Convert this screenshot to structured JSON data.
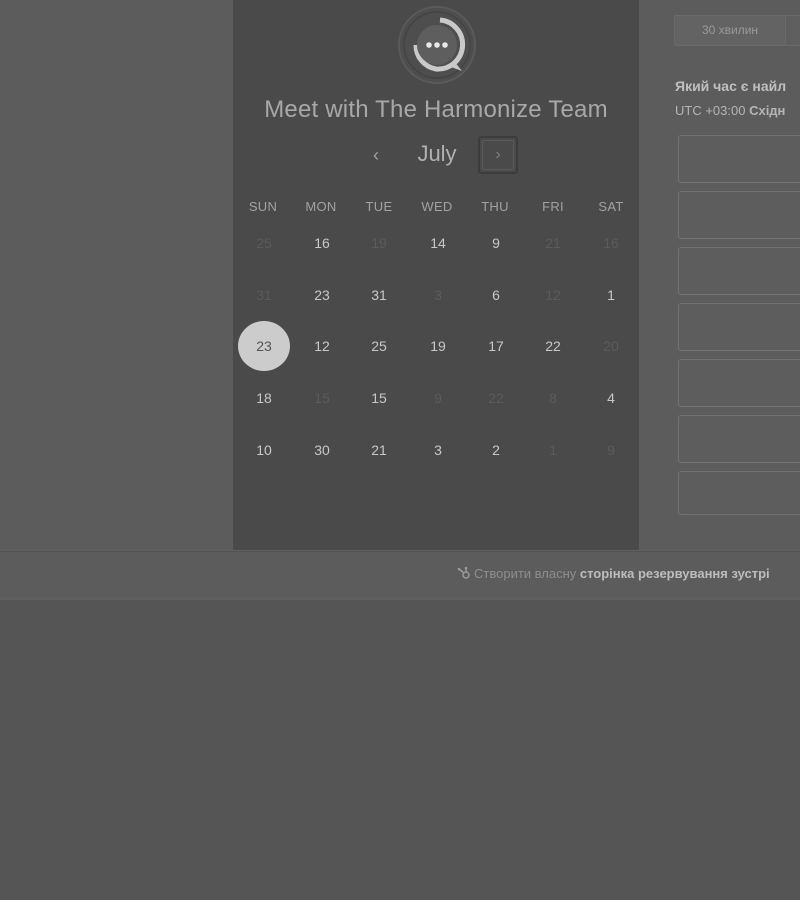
{
  "scheduler": {
    "title": "Meet with The Harmonize Team",
    "logo_icon": "chat-bubble-icon",
    "month": "July",
    "prev_icon": "‹",
    "next_icon": "›",
    "weekdays": [
      "SUN",
      "MON",
      "TUE",
      "WED",
      "THU",
      "FRI",
      "SAT"
    ],
    "weeks": [
      [
        {
          "d": "25",
          "muted": true
        },
        {
          "d": "16",
          "muted": false
        },
        {
          "d": "19",
          "muted": true
        },
        {
          "d": "14",
          "muted": false
        },
        {
          "d": "9",
          "muted": false
        },
        {
          "d": "21",
          "muted": true
        },
        {
          "d": "16",
          "muted": true
        }
      ],
      [
        {
          "d": "31",
          "muted": true
        },
        {
          "d": "23",
          "muted": false
        },
        {
          "d": "31",
          "muted": false
        },
        {
          "d": "3",
          "muted": true
        },
        {
          "d": "6",
          "muted": false
        },
        {
          "d": "12",
          "muted": true
        },
        {
          "d": "1",
          "muted": false
        }
      ],
      [
        {
          "d": "23",
          "muted": false,
          "selected": true
        },
        {
          "d": "12",
          "muted": false
        },
        {
          "d": "25",
          "muted": false
        },
        {
          "d": "19",
          "muted": false
        },
        {
          "d": "17",
          "muted": false
        },
        {
          "d": "22",
          "muted": false
        },
        {
          "d": "20",
          "muted": true
        }
      ],
      [
        {
          "d": "18",
          "muted": false
        },
        {
          "d": "15",
          "muted": true
        },
        {
          "d": "15",
          "muted": false
        },
        {
          "d": "9",
          "muted": true
        },
        {
          "d": "22",
          "muted": true
        },
        {
          "d": "8",
          "muted": true
        },
        {
          "d": "4",
          "muted": false
        }
      ],
      [
        {
          "d": "10",
          "muted": false
        },
        {
          "d": "30",
          "muted": false
        },
        {
          "d": "21",
          "muted": false
        },
        {
          "d": "3",
          "muted": false
        },
        {
          "d": "2",
          "muted": false
        },
        {
          "d": "1",
          "muted": true
        },
        {
          "d": "9",
          "muted": true
        }
      ]
    ]
  },
  "booking": {
    "duration_tab": "30 хвилин",
    "question": "Який час є найл",
    "timezone_prefix": "UTC +03:00 ",
    "timezone_name": "Східн",
    "slot_count_visible": 7
  },
  "footer": {
    "icon": "hubspot-sprocket-icon",
    "text_plain": "Створити власну ",
    "text_bold": "сторінка резервування зустрі"
  },
  "colors": {
    "page_bg": "#555555",
    "panel_bg": "#4a4a4a",
    "selected_day": "#cccccc"
  }
}
